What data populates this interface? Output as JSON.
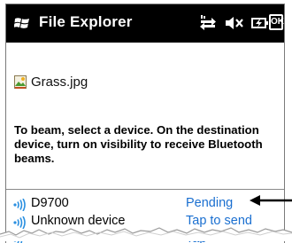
{
  "titlebar": {
    "app_title": "File Explorer",
    "ok_label": "OK",
    "icons": [
      "windows-flag-icon",
      "connectivity-icon",
      "volume-muted-icon",
      "battery-charging-icon"
    ]
  },
  "file": {
    "name": "Grass.jpg",
    "icon": "image-file-icon"
  },
  "instructions": "To beam, select a device. On the destination device, turn on visibility to receive Bluetooth beams.",
  "devices": [
    {
      "name": "D9700",
      "status": "Pending"
    },
    {
      "name": "Unknown device",
      "status": "Tap to send"
    },
    {
      "name": "",
      "status": "Tap"
    }
  ],
  "colors": {
    "titlebar": "#000000",
    "status_link": "#1a6fd0",
    "bluetooth_icon": "#2a8fe0",
    "annotation_arrow": "#000000"
  }
}
